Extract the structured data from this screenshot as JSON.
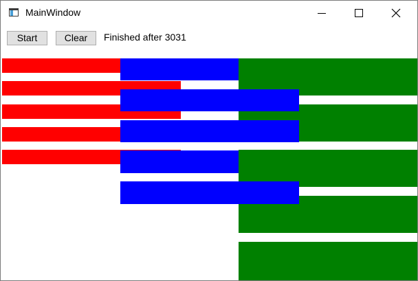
{
  "window": {
    "title": "MainWindow"
  },
  "toolbar": {
    "start_label": "Start",
    "clear_label": "Clear",
    "status_text": "Finished after 3031"
  },
  "colors": {
    "red": "#ff0000",
    "blue": "#0000ff",
    "green": "#008000"
  },
  "icons": {
    "app": "window-app-icon",
    "minimize": "minimize-icon",
    "maximize": "maximize-icon",
    "close": "close-icon"
  }
}
